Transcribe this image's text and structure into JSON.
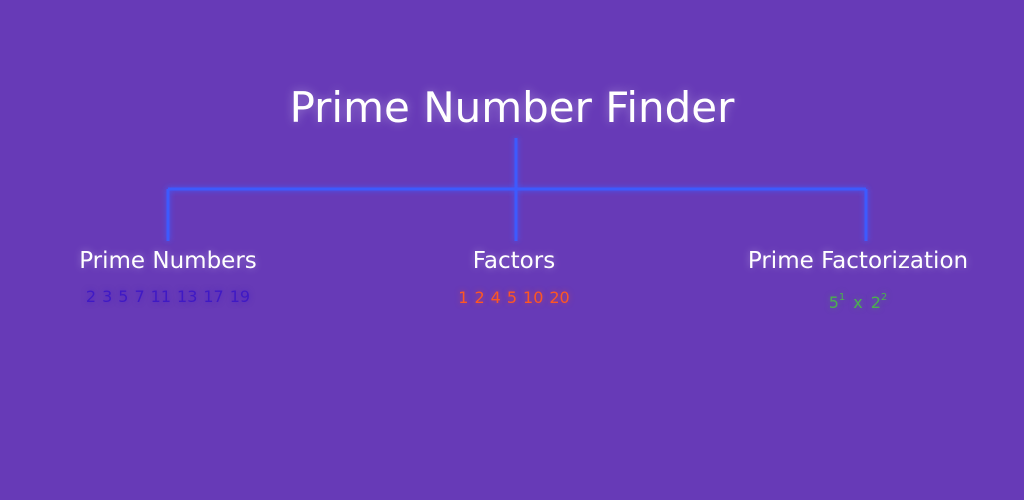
{
  "title": "Prime Number Finder",
  "colors": {
    "background": "#673ab7",
    "connector": "#3d5afe",
    "primes": "#3f19c4",
    "factors": "#ff5722",
    "factorization": "#4caf50"
  },
  "branches": {
    "primes": {
      "label": "Prime Numbers",
      "values": [
        "2",
        "3",
        "5",
        "7",
        "11",
        "13",
        "17",
        "19"
      ]
    },
    "factors": {
      "label": "Factors",
      "values": [
        "1",
        "2",
        "4",
        "5",
        "10",
        "20"
      ]
    },
    "factorization": {
      "label": "Prime Factorization",
      "terms": [
        {
          "base": "5",
          "exp": "1"
        },
        {
          "base": "2",
          "exp": "2"
        }
      ],
      "operator": "x"
    }
  }
}
